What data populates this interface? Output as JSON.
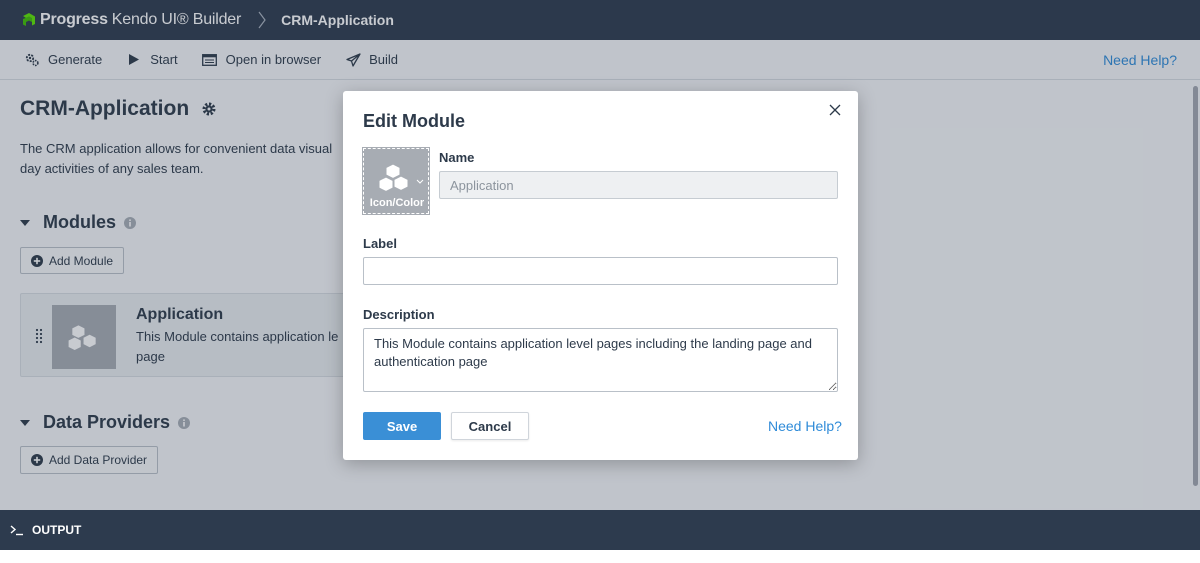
{
  "titlebar": {
    "brand": "Progress",
    "product": "Kendo UI® Builder",
    "project": "CRM-Application",
    "icons": {
      "logo": "progress-logo-icon",
      "separator": "breadcrumb-chevron-icon"
    }
  },
  "toolbar": {
    "buttons": [
      {
        "label": "Generate",
        "icon": "gears-icon"
      },
      {
        "label": "Start",
        "icon": "play-icon"
      },
      {
        "label": "Open in browser",
        "icon": "browser-window-icon"
      },
      {
        "label": "Build",
        "icon": "paper-plane-icon"
      }
    ],
    "help": "Need Help?"
  },
  "main": {
    "title": "CRM-Application",
    "description": "The CRM application allows for convenient data visual… day activities of any sales team.",
    "description_lines": [
      "The CRM application allows for convenient data visual",
      "day activities of any sales team."
    ],
    "modules": {
      "heading": "Modules",
      "add_label": "Add Module",
      "items": [
        {
          "name": "Application",
          "description": "This Module contains application le",
          "description_line2": "page",
          "icon": "cubes-icon"
        }
      ]
    },
    "data_providers": {
      "heading": "Data Providers",
      "add_label": "Add Data Provider"
    }
  },
  "output": {
    "label": "OUTPUT"
  },
  "modal": {
    "title": "Edit Module",
    "icon_picker_label": "Icon/Color",
    "name_label": "Name",
    "name_value": "Application",
    "label_label": "Label",
    "label_value": "",
    "description_label": "Description",
    "description_value": "This Module contains application level pages including the landing page and authentication page",
    "save": "Save",
    "cancel": "Cancel",
    "help": "Need Help?"
  },
  "colors": {
    "header_bg": "#2d3b4e",
    "accent": "#3a8fd6",
    "link": "#2f8bd8",
    "brand_green": "#5ce500"
  }
}
